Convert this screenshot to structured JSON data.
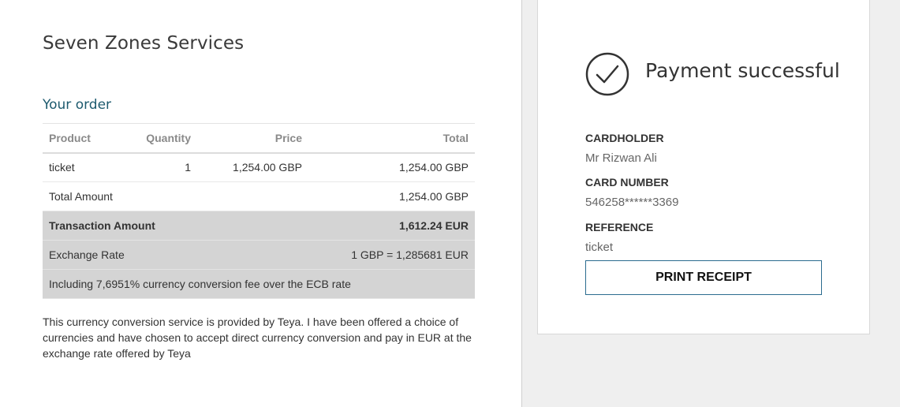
{
  "merchant": {
    "name": "Seven Zones Services"
  },
  "order": {
    "heading": "Your order",
    "columns": {
      "product": "Product",
      "quantity": "Quantity",
      "price": "Price",
      "total": "Total"
    },
    "items": [
      {
        "product": "ticket",
        "quantity": "1",
        "price": "1,254.00 GBP",
        "total": "1,254.00 GBP"
      }
    ],
    "total_amount": {
      "label": "Total Amount",
      "value": "1,254.00 GBP"
    },
    "transaction_amount": {
      "label": "Transaction Amount",
      "value": "1,612.24 EUR"
    },
    "exchange_rate": {
      "label": "Exchange Rate",
      "value": "1 GBP = 1,285681 EUR"
    },
    "fee_note": "Including 7,6951% currency conversion fee over the ECB rate",
    "disclaimer": "This currency conversion service is provided by Teya. I have been offered a choice of currencies and have chosen to accept direct currency conversion and pay in EUR at the exchange rate offered by Teya"
  },
  "receipt": {
    "status": "Payment successful",
    "status_icon": "check-circle-icon",
    "cardholder_label": "CARDHOLDER",
    "cardholder_value": "Mr Rizwan Ali",
    "card_number_label": "CARD NUMBER",
    "card_number_value": "546258******3369",
    "reference_label": "REFERENCE",
    "reference_value": "ticket",
    "print_button": "PRINT RECEIPT"
  },
  "colors": {
    "accent": "#1d5a6e",
    "button_border": "#2b6c8f",
    "grey_row": "#d4d4d4",
    "background": "#efefef"
  }
}
